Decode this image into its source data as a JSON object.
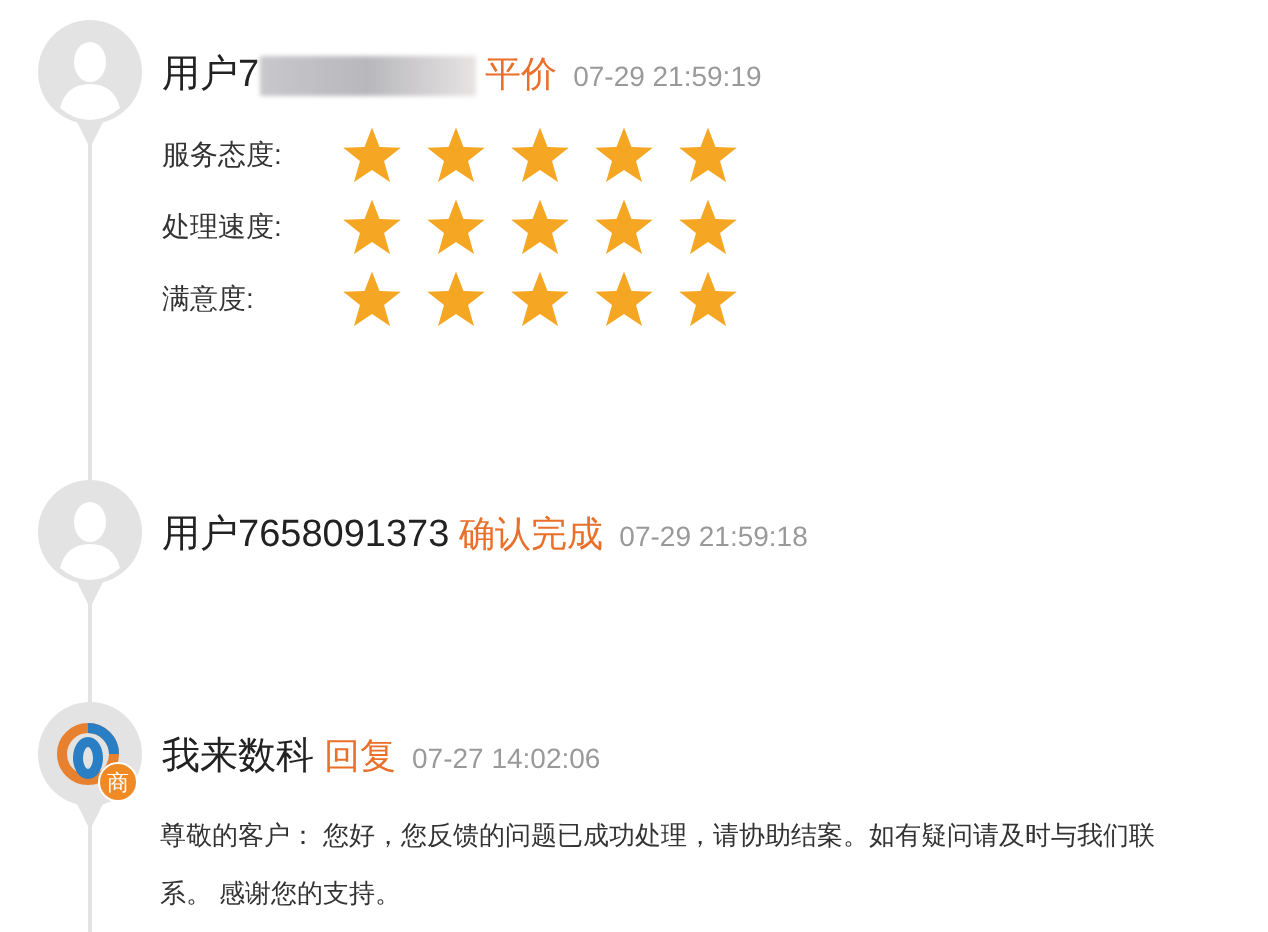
{
  "entries": [
    {
      "kind": "rating",
      "user": "用户7",
      "redacted": true,
      "action": "平价",
      "time": "07-29 21:59:19",
      "ratings": [
        {
          "label": "服务态度:",
          "stars": 5
        },
        {
          "label": "处理速度:",
          "stars": 5
        },
        {
          "label": "满意度:",
          "stars": 5
        }
      ]
    },
    {
      "kind": "plain",
      "user": "用户7658091373",
      "redacted": false,
      "action": "确认完成",
      "time": "07-29 21:59:18"
    },
    {
      "kind": "reply",
      "badge": "商",
      "user": "我来数科",
      "redacted": false,
      "action": "回复",
      "time": "07-27 14:02:06",
      "message": "尊敬的客户： 您好，您反馈的问题已成功处理，请协助结案。如有疑问请及时与我们联系。 感谢您的支持。"
    }
  ]
}
